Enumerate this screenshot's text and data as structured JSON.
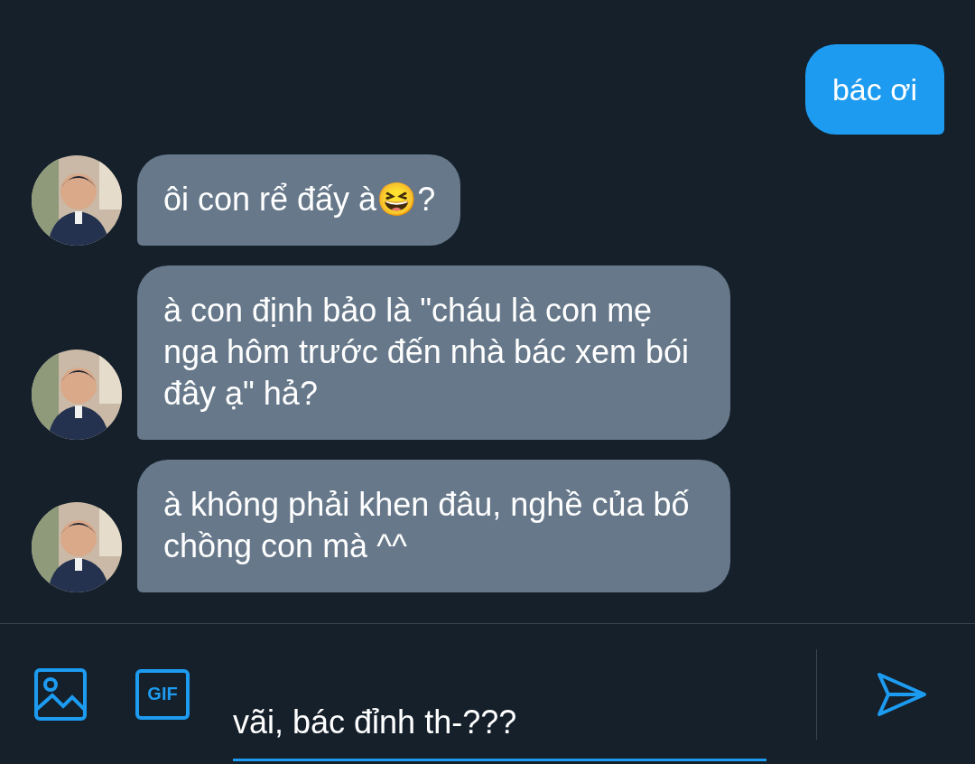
{
  "messages": [
    {
      "kind": "sent",
      "text": "bác ơi"
    },
    {
      "kind": "received",
      "text": "ôi con rể đấy à😆?"
    },
    {
      "kind": "received",
      "text": "à con định bảo là \"cháu là con mẹ nga hôm trước đến nhà bác xem bói đây ạ\" hả?"
    },
    {
      "kind": "received",
      "text": "à không phải khen đâu, nghề của bố chồng con mà ^^"
    }
  ],
  "composer": {
    "buttons": [
      {
        "kind": "image"
      },
      {
        "kind": "gif",
        "label": "GIF"
      }
    ],
    "value": "vãi, bác đỉnh th-???"
  }
}
